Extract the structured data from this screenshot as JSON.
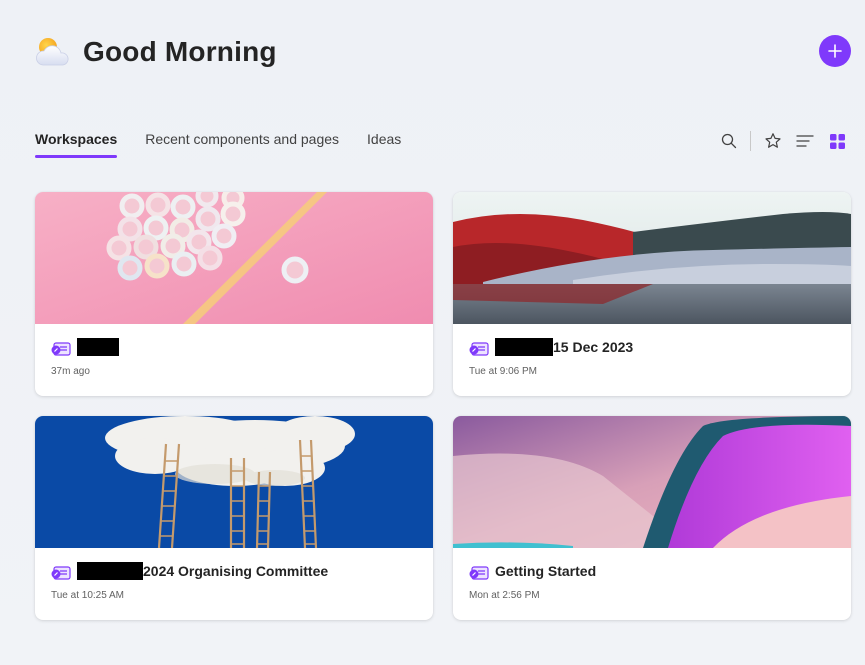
{
  "header": {
    "greeting": "Good Morning",
    "weather_icon": "partly-cloudy-icon",
    "add_icon": "plus-icon"
  },
  "tabs": [
    {
      "label": "Workspaces",
      "active": true
    },
    {
      "label": "Recent components and pages",
      "active": false
    },
    {
      "label": "Ideas",
      "active": false
    }
  ],
  "toolbar": {
    "icons": [
      "search-icon",
      "star-icon",
      "list-view-icon",
      "grid-view-icon"
    ]
  },
  "colors": {
    "accent": "#7f39fb",
    "text": "#242424",
    "subtext": "#616161"
  },
  "cards": [
    {
      "name": "",
      "time": "37m ago",
      "redacted": true,
      "image": "pink-candy-rings"
    },
    {
      "name": "15 Dec 2023",
      "time": "Tue at 9:06 PM",
      "redacted": true,
      "image": "red-hills-landscape"
    },
    {
      "name": "2024 Organising Committee",
      "time": "Tue at 10:25 AM",
      "redacted": true,
      "image": "cloud-with-ladders"
    },
    {
      "name": "Getting Started",
      "time": "Mon at 2:56 PM",
      "redacted": false,
      "image": "purple-abstract-wave"
    }
  ]
}
